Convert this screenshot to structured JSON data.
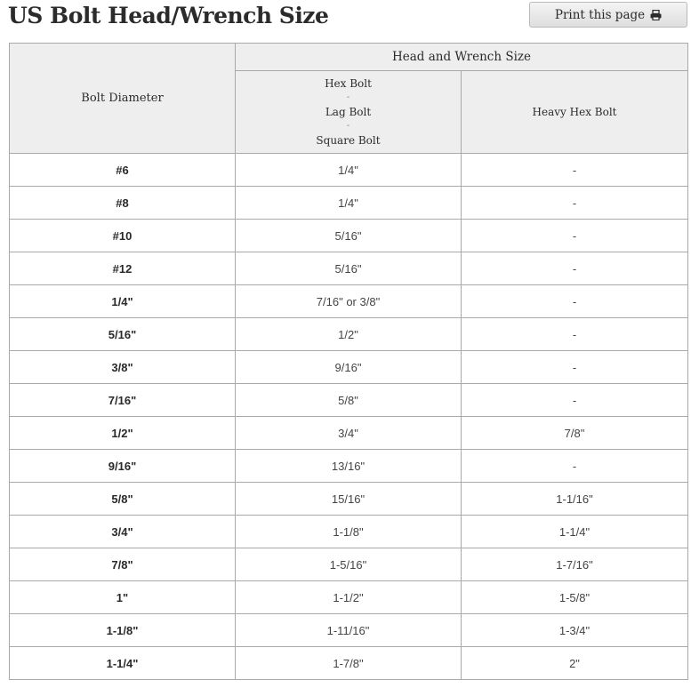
{
  "page": {
    "title": "US Bolt Head/Wrench Size",
    "print_label": "Print this page",
    "print_icon": "printer-icon"
  },
  "table": {
    "col_header_diameter": "Bolt Diameter",
    "group_header": "Head and Wrench Size",
    "sub_header_hex": [
      "Hex Bolt",
      "-",
      "Lag Bolt",
      "-",
      "Square Bolt"
    ],
    "sub_header_heavy": "Heavy Hex Bolt",
    "rows": [
      {
        "diameter": "#6",
        "hex": "1/4\"",
        "heavy": "-"
      },
      {
        "diameter": "#8",
        "hex": "1/4\"",
        "heavy": "-"
      },
      {
        "diameter": "#10",
        "hex": "5/16\"",
        "heavy": "-"
      },
      {
        "diameter": "#12",
        "hex": "5/16\"",
        "heavy": "-"
      },
      {
        "diameter": "1/4\"",
        "hex": "7/16\" or 3/8\"",
        "heavy": "-"
      },
      {
        "diameter": "5/16\"",
        "hex": "1/2\"",
        "heavy": "-"
      },
      {
        "diameter": "3/8\"",
        "hex": "9/16\"",
        "heavy": "-"
      },
      {
        "diameter": "7/16\"",
        "hex": "5/8\"",
        "heavy": "-"
      },
      {
        "diameter": "1/2\"",
        "hex": "3/4\"",
        "heavy": "7/8\""
      },
      {
        "diameter": "9/16\"",
        "hex": "13/16\"",
        "heavy": "-"
      },
      {
        "diameter": "5/8\"",
        "hex": "15/16\"",
        "heavy": "1-1/16\""
      },
      {
        "diameter": "3/4\"",
        "hex": "1-1/8\"",
        "heavy": "1-1/4\""
      },
      {
        "diameter": "7/8\"",
        "hex": "1-5/16\"",
        "heavy": "1-7/16\""
      },
      {
        "diameter": "1\"",
        "hex": "1-1/2\"",
        "heavy": "1-5/8\""
      },
      {
        "diameter": "1-1/8\"",
        "hex": "1-11/16\"",
        "heavy": "1-3/4\""
      },
      {
        "diameter": "1-1/4\"",
        "hex": "1-7/8\"",
        "heavy": "2\""
      }
    ]
  }
}
